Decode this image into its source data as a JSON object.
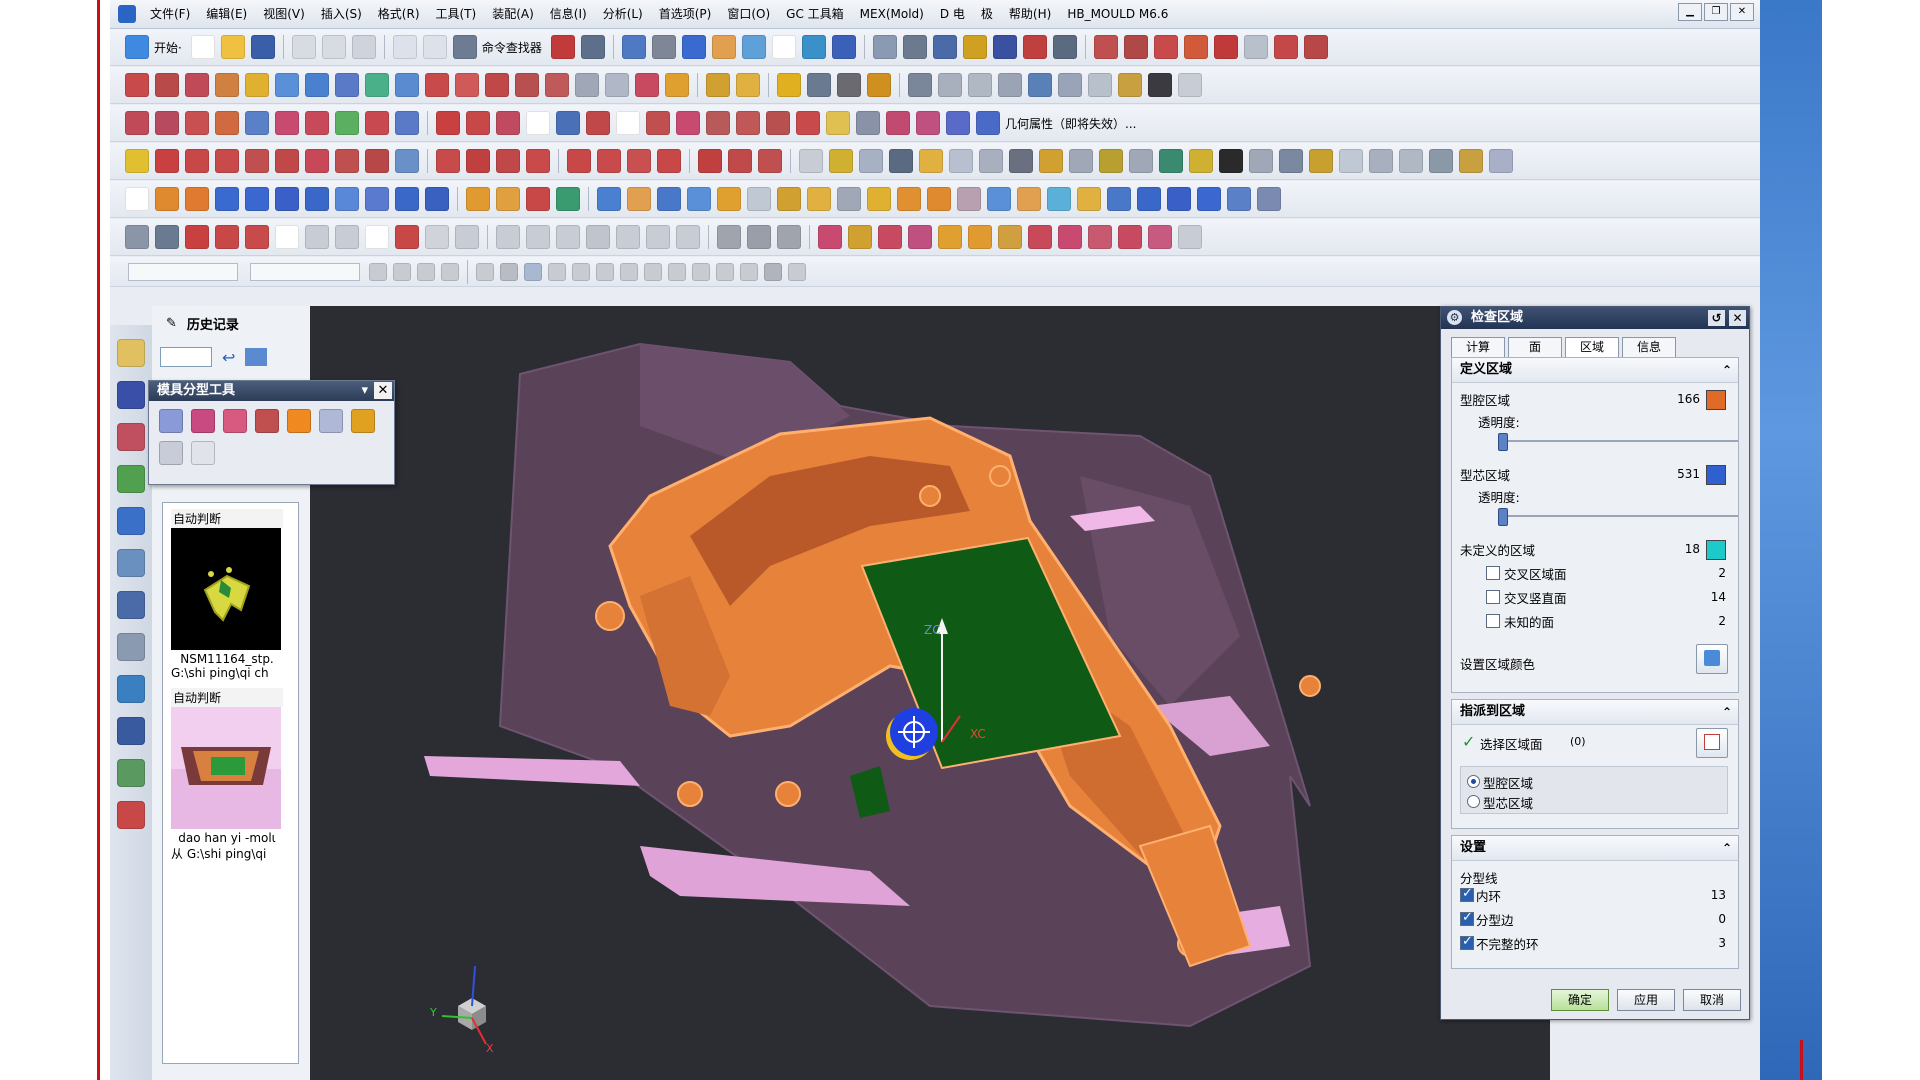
{
  "menu": [
    "文件(F)",
    "编辑(E)",
    "视图(V)",
    "插入(S)",
    "格式(R)",
    "工具(T)",
    "装配(A)",
    "信息(I)",
    "分析(L)",
    "首选项(P)",
    "窗口(O)",
    "GC 工具箱",
    "MEX(Mold)",
    "D 电",
    "极",
    "帮助(H)",
    "HB_MOULD M6.6"
  ],
  "toolbar": {
    "start_label": "开始·",
    "command_finder": "命令查找器",
    "attr_label": "几何属性（即将失效）..."
  },
  "history": {
    "title": "历史记录",
    "cards": [
      {
        "tag": "自动判断",
        "name": "NSM11164_stp.",
        "path": "G:\\shi ping\\qi ch"
      },
      {
        "tag": "自动判断",
        "name": "dao han yi -molι",
        "path": "从 G:\\shi ping\\qi"
      }
    ]
  },
  "mold_tools": {
    "title": "模具分型工具"
  },
  "dialog": {
    "title": "检查区域",
    "tabs": [
      "计算",
      "面",
      "区域",
      "信息"
    ],
    "active_tab": "区域",
    "define": {
      "header": "定义区域",
      "cavity_label": "型腔区域",
      "cavity_count": "166",
      "cavity_color": "#e06a28",
      "trans_label": "透明度:",
      "core_label": "型芯区域",
      "core_count": "531",
      "core_color": "#2f5fd0",
      "trans_label2": "透明度:",
      "undef_label": "未定义的区域",
      "undef_count": "18",
      "undef_color": "#1ec9c9",
      "sub": [
        {
          "label": "交叉区域面",
          "count": "2"
        },
        {
          "label": "交叉竖直面",
          "count": "14"
        },
        {
          "label": "未知的面",
          "count": "2"
        }
      ],
      "set_color_label": "设置区域颜色"
    },
    "assign": {
      "header": "指派到区域",
      "select_label": "选择区域面",
      "select_count": "(0)",
      "radio": [
        "型腔区域",
        "型芯区域"
      ]
    },
    "settings": {
      "header": "设置",
      "group_label": "分型线",
      "items": [
        {
          "label": "内环",
          "count": "13"
        },
        {
          "label": "分型边",
          "count": "0"
        },
        {
          "label": "不完整的环",
          "count": "3"
        }
      ]
    },
    "buttons": {
      "ok": "确定",
      "apply": "应用",
      "cancel": "取消"
    }
  },
  "viewport": {
    "zc_label": "ZC",
    "xc_label": "XC",
    "y_label": "Y",
    "x_label": "X"
  }
}
